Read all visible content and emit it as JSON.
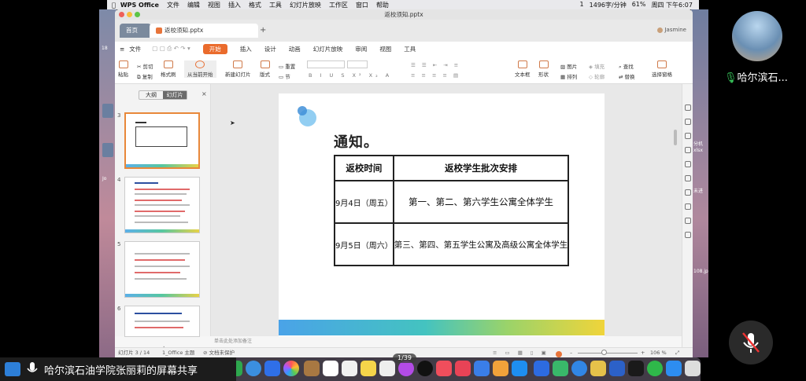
{
  "menubar": {
    "app": "WPS Office",
    "items": [
      "文件",
      "编辑",
      "视图",
      "插入",
      "格式",
      "工具",
      "幻灯片放映",
      "工作区",
      "窗口",
      "帮助"
    ],
    "status": [
      "1",
      "1496字/分钟",
      "61%",
      "周四 下午6:07"
    ]
  },
  "window": {
    "title": "返校须知.pptx"
  },
  "tabs": {
    "home": "首页",
    "doc": "返校须知.pptx",
    "user": "Jasmine"
  },
  "ribbon_tabs": [
    "文件",
    "开始",
    "插入",
    "设计",
    "动画",
    "幻灯片放映",
    "审阅",
    "视图",
    "工具"
  ],
  "ribbon": {
    "paste": "粘贴",
    "cut": "剪切",
    "copy": "复制",
    "format_painter": "格式刷",
    "play_from": "从当前开始",
    "new_slide": "新建幻灯片",
    "layout": "版式",
    "reset": "重置",
    "section": "节",
    "textbox": "文本框",
    "shape": "形状",
    "picture": "图片",
    "arrange": "排列",
    "fill": "填充",
    "outline": "轮廓",
    "find": "查找",
    "replace": "替换",
    "select_pane": "选择窗格"
  },
  "panel": {
    "outline_tab": "大纲",
    "slides_tab": "幻灯片",
    "slide_numbers": [
      "3",
      "4",
      "5",
      "6"
    ]
  },
  "slide": {
    "heading": "通知。",
    "table": {
      "headers": [
        "返校时间",
        "返校学生批次安排"
      ],
      "rows": [
        [
          "9月4日（周五）",
          "第一、第二、第六学生公寓全体学生"
        ],
        [
          "9月5日（周六）",
          "第三、第四、第五学生公寓及高级公寓全体学生"
        ]
      ]
    }
  },
  "notes_placeholder": "单击此处添加备注",
  "status": {
    "slide_counter": "幻灯片 3 / 14",
    "theme": "1_Office 主题",
    "protect": "文档未保护",
    "zoom": "106 %"
  },
  "page_badge": "1/39",
  "share_text": "哈尔滨石油学院张丽莉的屏幕共享",
  "participant_name": "哈尔滨石...",
  "desktop_labels": [
    "18",
    "Jo",
    "分机",
    "xlsx",
    "未进",
    "108.jp"
  ],
  "colors": {
    "accent": "#ea6b2c",
    "slide_bar_start": "#4aa3e8",
    "slide_bar_end": "#f0d43a"
  }
}
